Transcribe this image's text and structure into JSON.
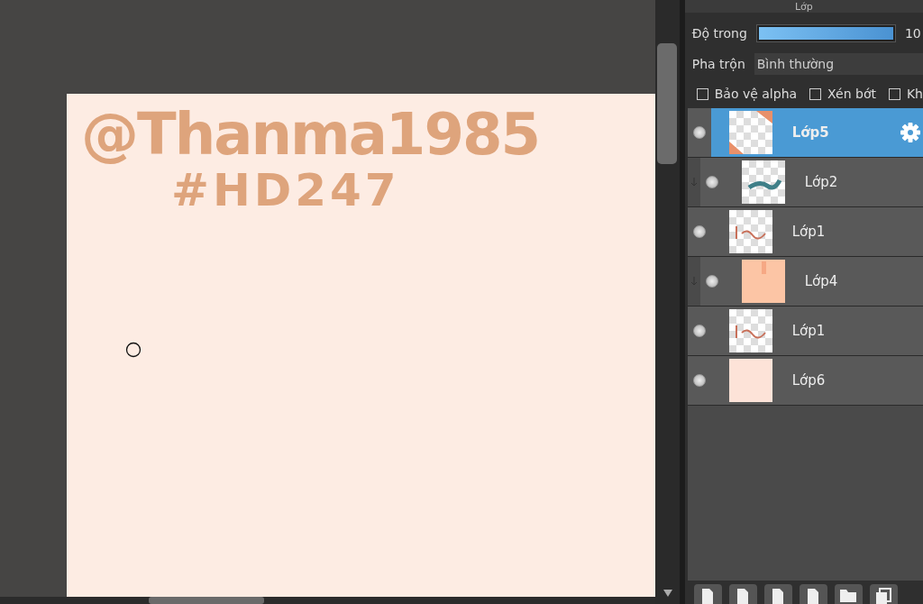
{
  "canvas": {
    "lines": [
      "@Thanma1985",
      "#HD247"
    ]
  },
  "panel": {
    "title": "Lớp",
    "opacity": {
      "label": "Độ trong",
      "level": 1,
      "reading": "10"
    },
    "blend": {
      "label": "Pha trộn",
      "value": "Bình thường"
    },
    "options": [
      {
        "label": "Bảo vệ alpha",
        "checked": false
      },
      {
        "label": "Xén bớt",
        "checked": false
      },
      {
        "label": "Kh",
        "checked": false
      }
    ],
    "layers": [
      {
        "name": "Lớp5",
        "selected": true,
        "clipped": false,
        "visible": true,
        "kind": "corners"
      },
      {
        "name": "Lớp2",
        "selected": false,
        "clipped": true,
        "visible": true,
        "kind": "stroke"
      },
      {
        "name": "Lớp1",
        "selected": false,
        "clipped": false,
        "visible": true,
        "kind": "lettering"
      },
      {
        "name": "Lớp4",
        "selected": false,
        "clipped": true,
        "visible": true,
        "kind": "fill"
      },
      {
        "name": "Lớp1",
        "selected": false,
        "clipped": false,
        "visible": true,
        "kind": "lettering"
      },
      {
        "name": "Lớp6",
        "selected": false,
        "clipped": false,
        "visible": true,
        "kind": "plain"
      }
    ]
  }
}
